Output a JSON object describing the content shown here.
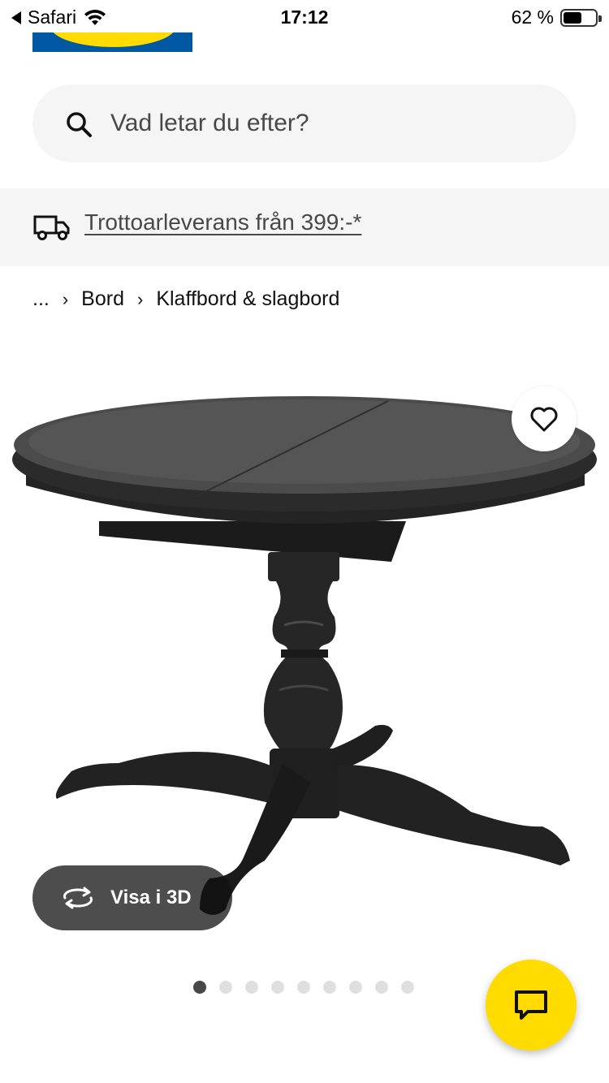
{
  "status_bar": {
    "back_app": "Safari",
    "time": "17:12",
    "battery": "62 %",
    "battery_level": 0.62
  },
  "search": {
    "placeholder": "Vad letar du efter?"
  },
  "delivery_banner": {
    "text": "Trottoarleverans från 399:-*"
  },
  "breadcrumb": {
    "items": [
      "...",
      "Bord",
      "Klaffbord & slagbord"
    ]
  },
  "product": {
    "view_3d_label": "Visa i 3D",
    "image_count": 9,
    "active_image": 1
  },
  "colors": {
    "brand_blue": "#0058a3",
    "brand_yellow": "#ffdb00",
    "surface_gray": "#f5f5f5",
    "text_dark": "#111111"
  },
  "icons": {
    "search": "search-icon",
    "delivery": "truck-icon",
    "favorite": "heart-icon",
    "view3d": "rotate-3d-icon",
    "chat": "chat-icon"
  }
}
